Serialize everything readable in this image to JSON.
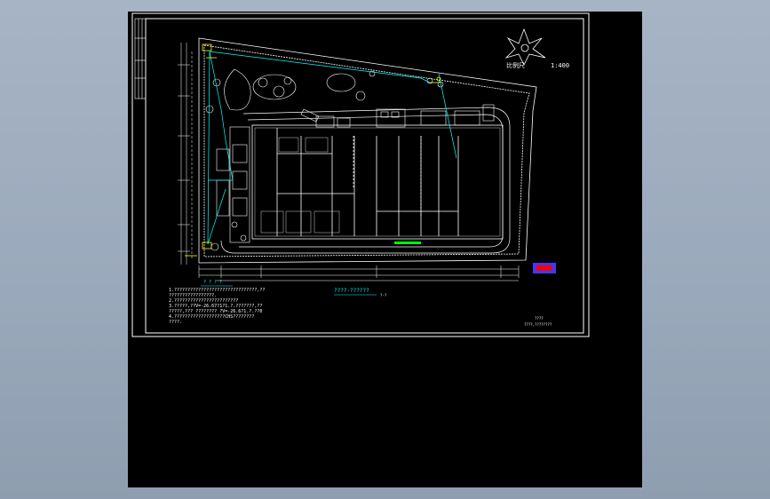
{
  "drawing": {
    "scale_label": "比例尺",
    "scale_value": "1:400",
    "title_text": "????-??????",
    "title_suffix": "?-?",
    "notes_heading": "? ? ? ?",
    "notes": [
      "1.???????????????????????????????,??",
      "  ?????????????????.",
      "2.????????????????????????",
      "3.?????,??V=-26.67?1?1.?.???????,??",
      "  ?????,??? ????????   ?V=-26.6?1.?.??0",
      "4.???????????????????CHS????????",
      "  ????."
    ],
    "title_block": {
      "line1": "????",
      "line2": "????,????????"
    }
  },
  "colors": {
    "window_bg": "#9aa8bb",
    "canvas_bg": "#000000",
    "linework": "#ffffff",
    "highlight": "#ffff00",
    "cyan": "#00ffff",
    "accent_blue": "#3b3bff",
    "accent_red": "#ff0000",
    "green": "#00ff00"
  }
}
